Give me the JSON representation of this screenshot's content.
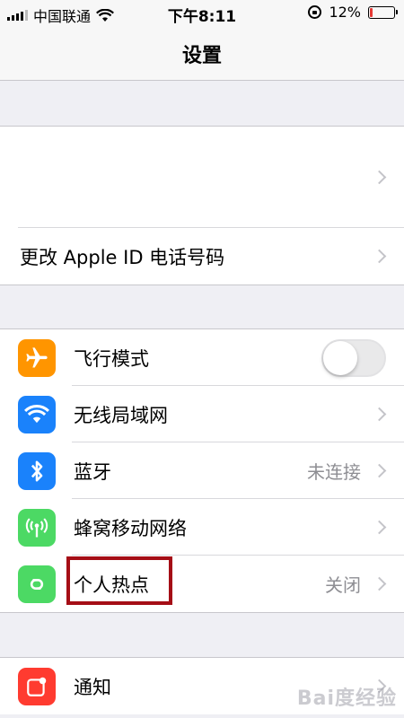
{
  "status_bar": {
    "carrier": "中国联通",
    "time": "下午8:11",
    "battery_text": "12%",
    "battery_level": 0.12
  },
  "nav": {
    "title": "设置"
  },
  "account_group": {
    "items": [
      {
        "label": ""
      },
      {
        "label": "更改 Apple ID 电话号码"
      }
    ]
  },
  "network_group": {
    "items": [
      {
        "label": "飞行模式",
        "icon": "airplane-icon",
        "color": "#ff9500",
        "toggle": false
      },
      {
        "label": "无线局域网",
        "icon": "wifi-icon",
        "color": "#1a82fb"
      },
      {
        "label": "蓝牙",
        "icon": "bluetooth-icon",
        "color": "#1a82fb",
        "detail": "未连接"
      },
      {
        "label": "蜂窝移动网络",
        "icon": "cellular-icon",
        "color": "#4cd964"
      },
      {
        "label": "个人热点",
        "icon": "hotspot-icon",
        "color": "#4cd964",
        "detail": "关闭"
      }
    ]
  },
  "notify_group": {
    "items": [
      {
        "label": "通知",
        "icon": "notification-icon",
        "color": "#ff3b30"
      }
    ]
  },
  "watermark": "Bai度经验"
}
